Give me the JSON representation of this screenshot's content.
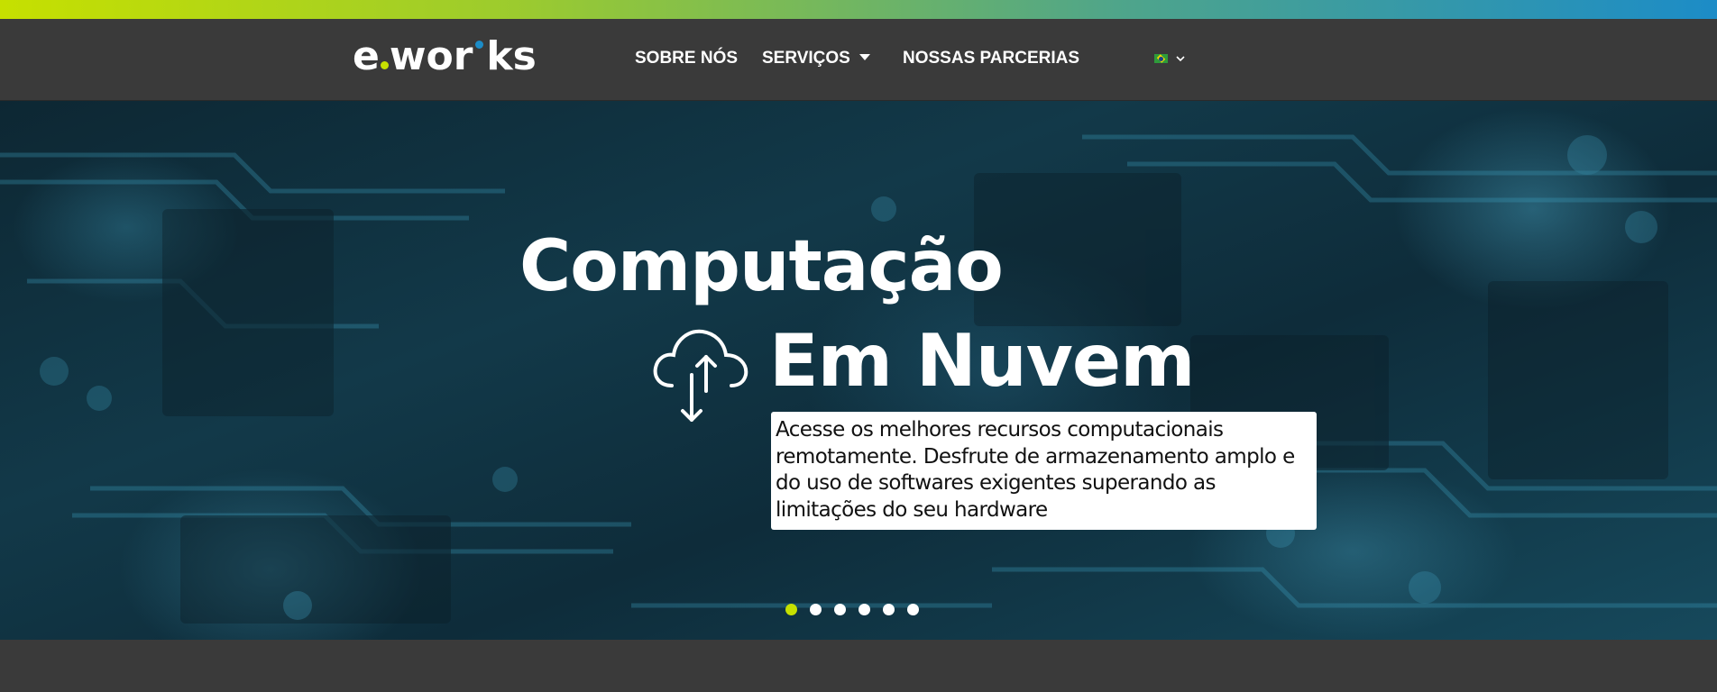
{
  "brand": {
    "logo_text_e": "e",
    "logo_text_wor": "wor",
    "logo_text_ks": "ks",
    "accent_green": "#c6e000",
    "accent_blue": "#1c8cc7"
  },
  "nav": {
    "items": [
      {
        "label": "SOBRE NÓS"
      },
      {
        "label": "SERVIÇOS"
      },
      {
        "label": "NOSSAS PARCERIAS"
      }
    ],
    "language": {
      "flag": "brazil-flag-icon",
      "chevron": "chevron-down-icon"
    }
  },
  "hero": {
    "title": "Computação",
    "subtitle": "Em Nuvem",
    "icon": "cloud-upload-download-icon",
    "description": "Acesse os melhores recursos computacionais remotamente. Desfrute de armazenamento amplo e do uso de softwares exigentes superando as limitações do seu hardware",
    "slides_total": 6,
    "active_slide": 1
  }
}
